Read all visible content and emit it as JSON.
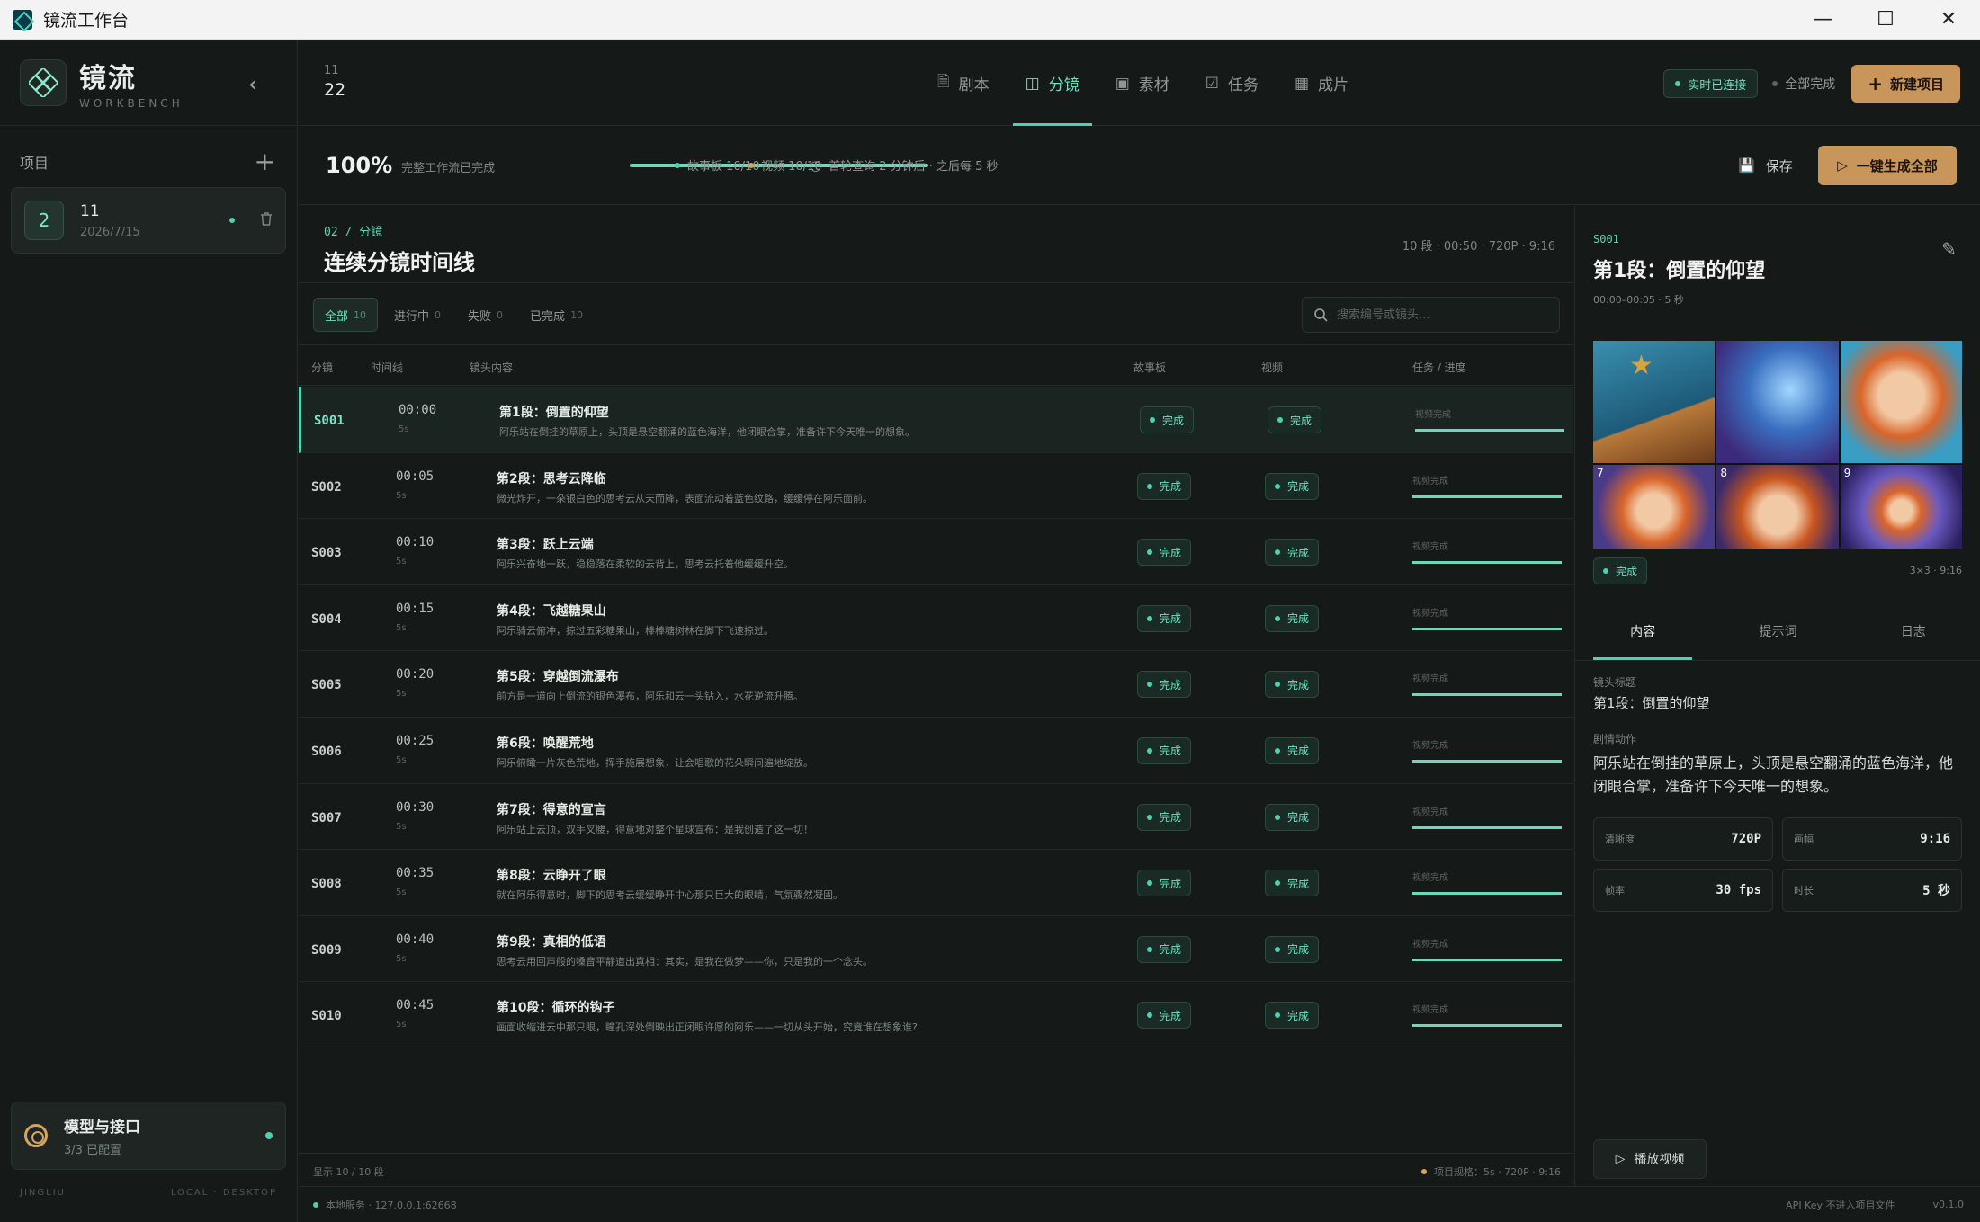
{
  "window": {
    "title": "镜流工作台"
  },
  "brand": {
    "name": "镜流",
    "sub": "WORKBENCH"
  },
  "sidebar": {
    "projects_label": "项目",
    "project": {
      "num": "2",
      "name": "11",
      "date": "2026/7/15"
    },
    "model": {
      "title": "模型与接口",
      "sub": "3/3 已配置"
    },
    "footer_left": "JINGLIU",
    "footer_right": "LOCAL · DESKTOP"
  },
  "header": {
    "crumb_top": "11",
    "crumb_bottom": "22",
    "tabs": [
      {
        "label": "剧本",
        "icon": "script-icon"
      },
      {
        "label": "分镜",
        "icon": "storyboard-icon"
      },
      {
        "label": "素材",
        "icon": "image-icon"
      },
      {
        "label": "任务",
        "icon": "task-icon"
      },
      {
        "label": "成片",
        "icon": "film-icon"
      }
    ],
    "live": "实时已连接",
    "all_done": "全部完成",
    "new_project": "新建项目"
  },
  "status": {
    "percent": "100%",
    "note": "完整工作流已完成",
    "progress": 1.0,
    "storyboard": "故事板 10/10",
    "video": "视频 10/10",
    "schedule": "首轮查询 2 分钟后 · 之后每 5 秒",
    "save": "保存",
    "generate_all": "一键生成全部"
  },
  "section": {
    "crumb": "02 / 分镜",
    "title": "连续分镜时间线",
    "meta": "10 段  ·  00:50  ·  720P · 9:16"
  },
  "filters": [
    {
      "label": "全部",
      "count": "10"
    },
    {
      "label": "进行中",
      "count": "0"
    },
    {
      "label": "失败",
      "count": "0"
    },
    {
      "label": "已完成",
      "count": "10"
    }
  ],
  "search": {
    "placeholder": "搜索编号或镜头..."
  },
  "table": {
    "headers": {
      "id": "分镜",
      "time": "时间线",
      "content": "镜头内容",
      "storyboard": "故事板",
      "video": "视频",
      "task": "任务 / 进度"
    },
    "done_label": "完成",
    "task_label": "视频完成",
    "rows": [
      {
        "id": "S001",
        "time": "00:00",
        "dur": "5s",
        "title": "第1段：倒置的仰望",
        "desc": "阿乐站在倒挂的草原上，头顶是悬空翻涌的蓝色海洋，他闭眼合掌，准备许下今天唯一的想象。",
        "progress": 1.0
      },
      {
        "id": "S002",
        "time": "00:05",
        "dur": "5s",
        "title": "第2段：思考云降临",
        "desc": "微光炸开，一朵银白色的思考云从天而降，表面流动着蓝色纹路，缓缓停在阿乐面前。",
        "progress": 1.0
      },
      {
        "id": "S003",
        "time": "00:10",
        "dur": "5s",
        "title": "第3段：跃上云端",
        "desc": "阿乐兴奋地一跃，稳稳落在柔软的云背上，思考云托着他缓缓升空。",
        "progress": 1.0
      },
      {
        "id": "S004",
        "time": "00:15",
        "dur": "5s",
        "title": "第4段：飞越糖果山",
        "desc": "阿乐骑云俯冲，掠过五彩糖果山，棒棒糖树林在脚下飞速掠过。",
        "progress": 1.0
      },
      {
        "id": "S005",
        "time": "00:20",
        "dur": "5s",
        "title": "第5段：穿越倒流瀑布",
        "desc": "前方是一道向上倒流的银色瀑布，阿乐和云一头钻入，水花逆流升腾。",
        "progress": 1.0
      },
      {
        "id": "S006",
        "time": "00:25",
        "dur": "5s",
        "title": "第6段：唤醒荒地",
        "desc": "阿乐俯瞰一片灰色荒地，挥手施展想象，让会唱歌的花朵瞬间遍地绽放。",
        "progress": 1.0
      },
      {
        "id": "S007",
        "time": "00:30",
        "dur": "5s",
        "title": "第7段：得意的宣言",
        "desc": "阿乐站上云顶，双手叉腰，得意地对整个星球宣布：是我创造了这一切！",
        "progress": 1.0
      },
      {
        "id": "S008",
        "time": "00:35",
        "dur": "5s",
        "title": "第8段：云睁开了眼",
        "desc": "就在阿乐得意时，脚下的思考云缓缓睁开中心那只巨大的眼睛，气氛骤然凝固。",
        "progress": 1.0
      },
      {
        "id": "S009",
        "time": "00:40",
        "dur": "5s",
        "title": "第9段：真相的低语",
        "desc": "思考云用回声般的嗓音平静道出真相：其实，是我在做梦——你，只是我的一个念头。",
        "progress": 1.0
      },
      {
        "id": "S010",
        "time": "00:45",
        "dur": "5s",
        "title": "第10段：循环的钩子",
        "desc": "画面收缩进云中那只眼，瞳孔深处倒映出正闭眼许愿的阿乐——一切从头开始，究竟谁在想象谁?",
        "progress": 1.0
      }
    ]
  },
  "main_footer": {
    "left": "显示 10 / 10 段",
    "right": "项目规格：5s · 720P · 9:16"
  },
  "detail": {
    "id": "S001",
    "title": "第1段：倒置的仰望",
    "time": "00:00–00:05 · 5 秒",
    "cells": [
      "",
      "",
      "",
      "7",
      "8",
      "9"
    ],
    "badge": "完成",
    "grid_info": "3×3 · 9:16",
    "tabs": [
      "内容",
      "提示词",
      "日志"
    ],
    "label_title": "镜头标题",
    "value_title": "第1段：倒置的仰望",
    "label_action": "剧情动作",
    "value_action": "阿乐站在倒挂的草原上，头顶是悬空翻涌的蓝色海洋，他闭眼合掌，准备许下今天唯一的想象。",
    "specs": [
      {
        "k": "清晰度",
        "v": "720P"
      },
      {
        "k": "画幅",
        "v": "9:16"
      },
      {
        "k": "帧率",
        "v": "30 fps"
      },
      {
        "k": "时长",
        "v": "5 秒"
      }
    ],
    "play": "播放视频"
  },
  "app_footer": {
    "service": "本地服务 · 127.0.0.1:62668",
    "api_note": "API Key 不进入项目文件",
    "version": "v0.1.0"
  },
  "colors": {
    "accent": "#4fd1b0",
    "warm": "#c8955a",
    "bg": "#151a18"
  }
}
